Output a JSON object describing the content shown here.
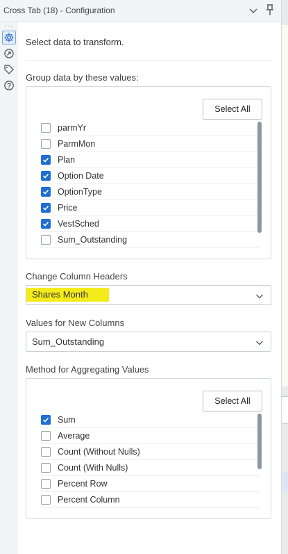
{
  "window": {
    "title": "Cross Tab (18) - Configuration"
  },
  "rail": {
    "icons": [
      "gear-icon",
      "arrow-circle-icon",
      "tag-icon",
      "help-icon"
    ]
  },
  "intro_text": "Select data to transform.",
  "group_section": {
    "label": "Group data by these values:",
    "select_all_label": "Select All",
    "items": [
      {
        "label": "parmYr",
        "checked": false
      },
      {
        "label": "ParmMon",
        "checked": false
      },
      {
        "label": "Plan",
        "checked": true
      },
      {
        "label": "Option Date",
        "checked": true
      },
      {
        "label": "OptionType",
        "checked": true
      },
      {
        "label": "Price",
        "checked": true
      },
      {
        "label": "VestSched",
        "checked": true
      },
      {
        "label": "Sum_Outstanding",
        "checked": false
      }
    ]
  },
  "headers_section": {
    "label": "Change Column Headers",
    "value": "Shares Month",
    "highlight_color": "#f3ec1a"
  },
  "values_section": {
    "label": "Values for New Columns",
    "value": "Sum_Outstanding"
  },
  "method_section": {
    "label": "Method for Aggregating Values",
    "select_all_label": "Select All",
    "items": [
      {
        "label": "Sum",
        "checked": true
      },
      {
        "label": "Average",
        "checked": false
      },
      {
        "label": "Count (Without Nulls)",
        "checked": false
      },
      {
        "label": "Count (With Nulls)",
        "checked": false
      },
      {
        "label": "Percent Row",
        "checked": false
      },
      {
        "label": "Percent Column",
        "checked": false
      }
    ]
  },
  "colors": {
    "accent": "#1f6ed4",
    "highlight": "#f3ec1a"
  }
}
